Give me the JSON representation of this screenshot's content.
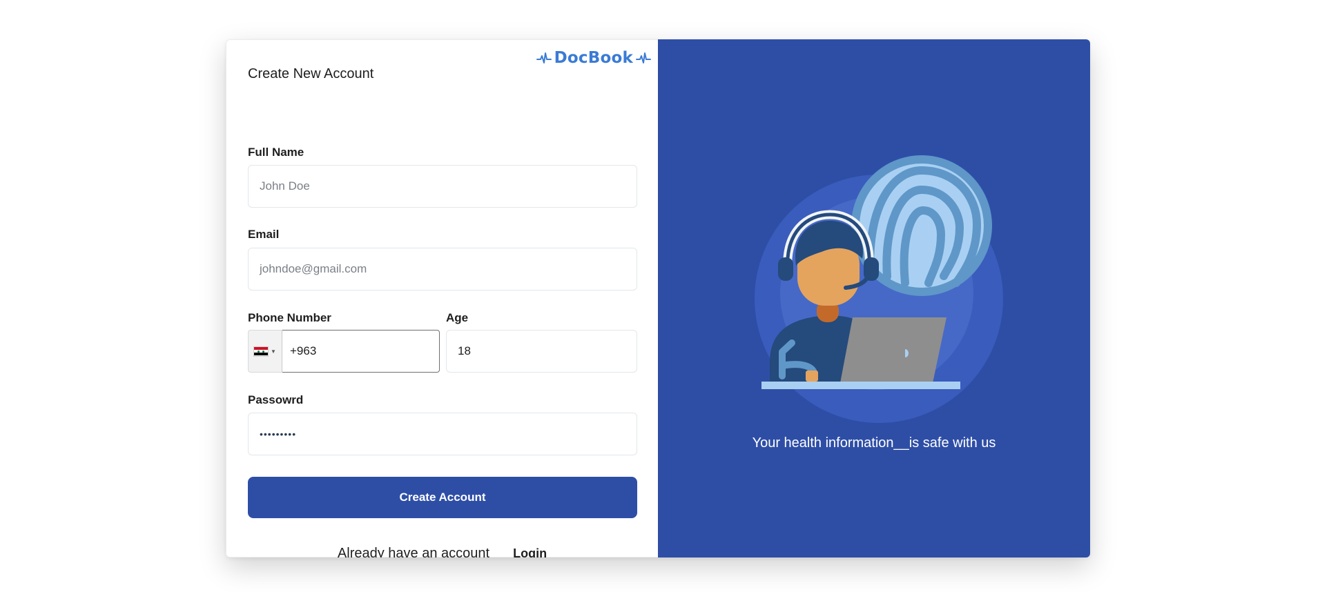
{
  "brand": {
    "name": "DocBook",
    "color": "#3a7bd5"
  },
  "form": {
    "title": "Create New Account",
    "full_name": {
      "label": "Full Name",
      "placeholder": "John Doe"
    },
    "email": {
      "label": "Email",
      "placeholder": "johndoe@gmail.com"
    },
    "phone": {
      "label": "Phone Number",
      "value": "+963",
      "flag_icon": "syria-flag-icon"
    },
    "age": {
      "label": "Age",
      "value": "18"
    },
    "password": {
      "label": "Passowrd",
      "value": "•••••••••"
    },
    "submit_label": "Create Account",
    "footer": {
      "prompt": "Already have an account",
      "login_label": "Login"
    }
  },
  "hero": {
    "caption": "Your health information__is safe with us",
    "illustration_icon": "support-agent-fingerprint-illustration"
  },
  "colors": {
    "primary": "#2e4ea6",
    "hero_bg": "#2e4ea6",
    "brand": "#3a7bd5"
  }
}
